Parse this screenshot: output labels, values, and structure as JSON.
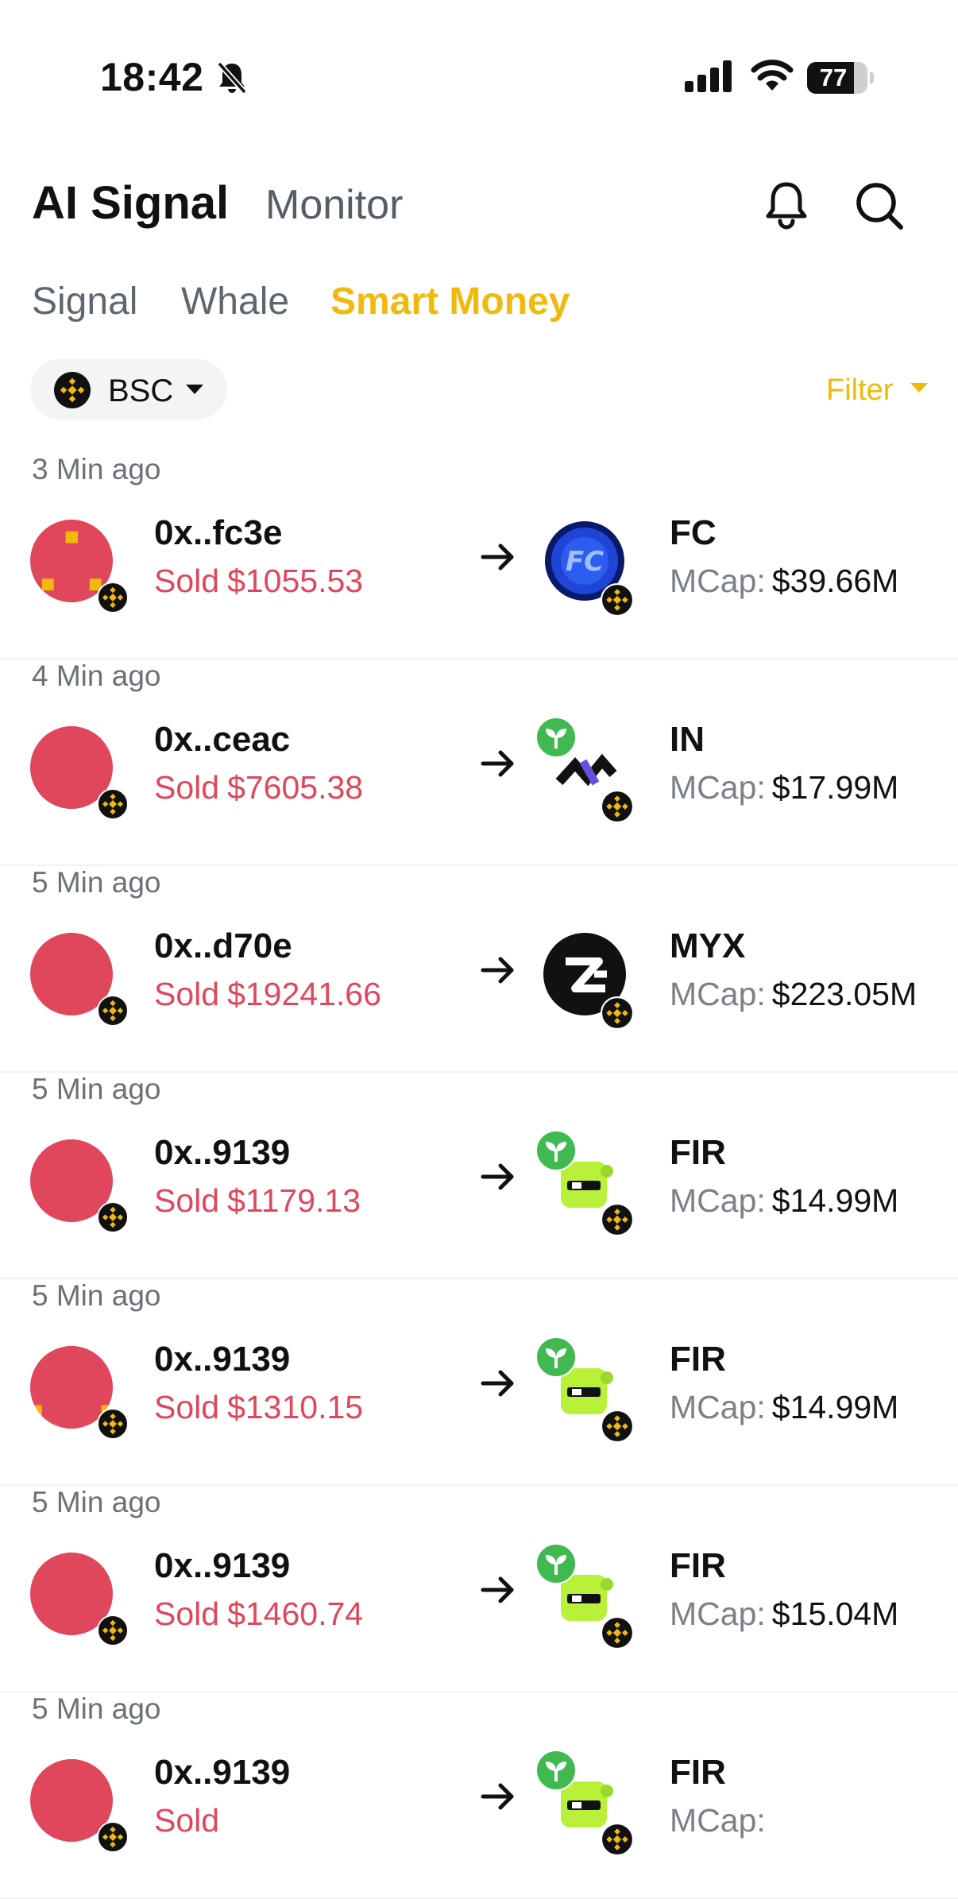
{
  "status_bar": {
    "time": "18:42",
    "battery": "77",
    "battery_level": 0.77
  },
  "header": {
    "title": "AI Signal",
    "monitor_tab": "Monitor"
  },
  "tabs": [
    {
      "label": "Signal",
      "active": false
    },
    {
      "label": "Whale",
      "active": false
    },
    {
      "label": "Smart Money",
      "active": true
    }
  ],
  "chain_selector": {
    "label": "BSC",
    "icon": "bnb-icon"
  },
  "filter": {
    "label": "Filter"
  },
  "colors": {
    "accent": "#f0b90b",
    "sold": "#e0475c",
    "muted": "#6b7177"
  },
  "rows": [
    {
      "time": "3 Min ago",
      "address": "0x..fc3e",
      "action": "Sold",
      "amount": "$1055.53",
      "token": "FC",
      "mcap_label": "MCap:",
      "mcap": "$39.66M",
      "logo": "fc-logo"
    },
    {
      "time": "4 Min ago",
      "address": "0x..ceac",
      "action": "Sold",
      "amount": "$7605.38",
      "token": "IN",
      "mcap_label": "MCap:",
      "mcap": "$17.99M",
      "logo": "in-logo"
    },
    {
      "time": "5 Min ago",
      "address": "0x..d70e",
      "action": "Sold",
      "amount": "$19241.66",
      "token": "MYX",
      "mcap_label": "MCap:",
      "mcap": "$223.05M",
      "logo": "myx-logo"
    },
    {
      "time": "5 Min ago",
      "address": "0x..9139",
      "action": "Sold",
      "amount": "$1179.13",
      "token": "FIR",
      "mcap_label": "MCap:",
      "mcap": "$14.99M",
      "logo": "fir-logo"
    },
    {
      "time": "5 Min ago",
      "address": "0x..9139",
      "action": "Sold",
      "amount": "$1310.15",
      "token": "FIR",
      "mcap_label": "MCap:",
      "mcap": "$14.99M",
      "logo": "fir-logo"
    },
    {
      "time": "5 Min ago",
      "address": "0x..9139",
      "action": "Sold",
      "amount": "$1460.74",
      "token": "FIR",
      "mcap_label": "MCap:",
      "mcap": "$15.04M",
      "logo": "fir-logo"
    },
    {
      "time": "5 Min ago",
      "address": "0x..9139",
      "action": "Sold",
      "amount": "",
      "token": "FIR",
      "mcap_label": "MCap:",
      "mcap": "",
      "logo": "fir-logo"
    }
  ]
}
